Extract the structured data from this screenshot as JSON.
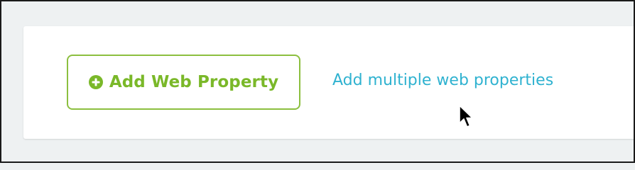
{
  "card": {
    "add_button": {
      "icon": "plus-circle-icon",
      "label": "Add Web Property"
    },
    "multi_link": {
      "label": "Add multiple web properties"
    }
  },
  "cursor": {
    "icon": "arrow-cursor-icon"
  },
  "colors": {
    "background": "#eef1f2",
    "card": "#ffffff",
    "accent_green": "#7ab829",
    "border_green": "#8cbf3f",
    "link_blue": "#2fb2d0"
  }
}
